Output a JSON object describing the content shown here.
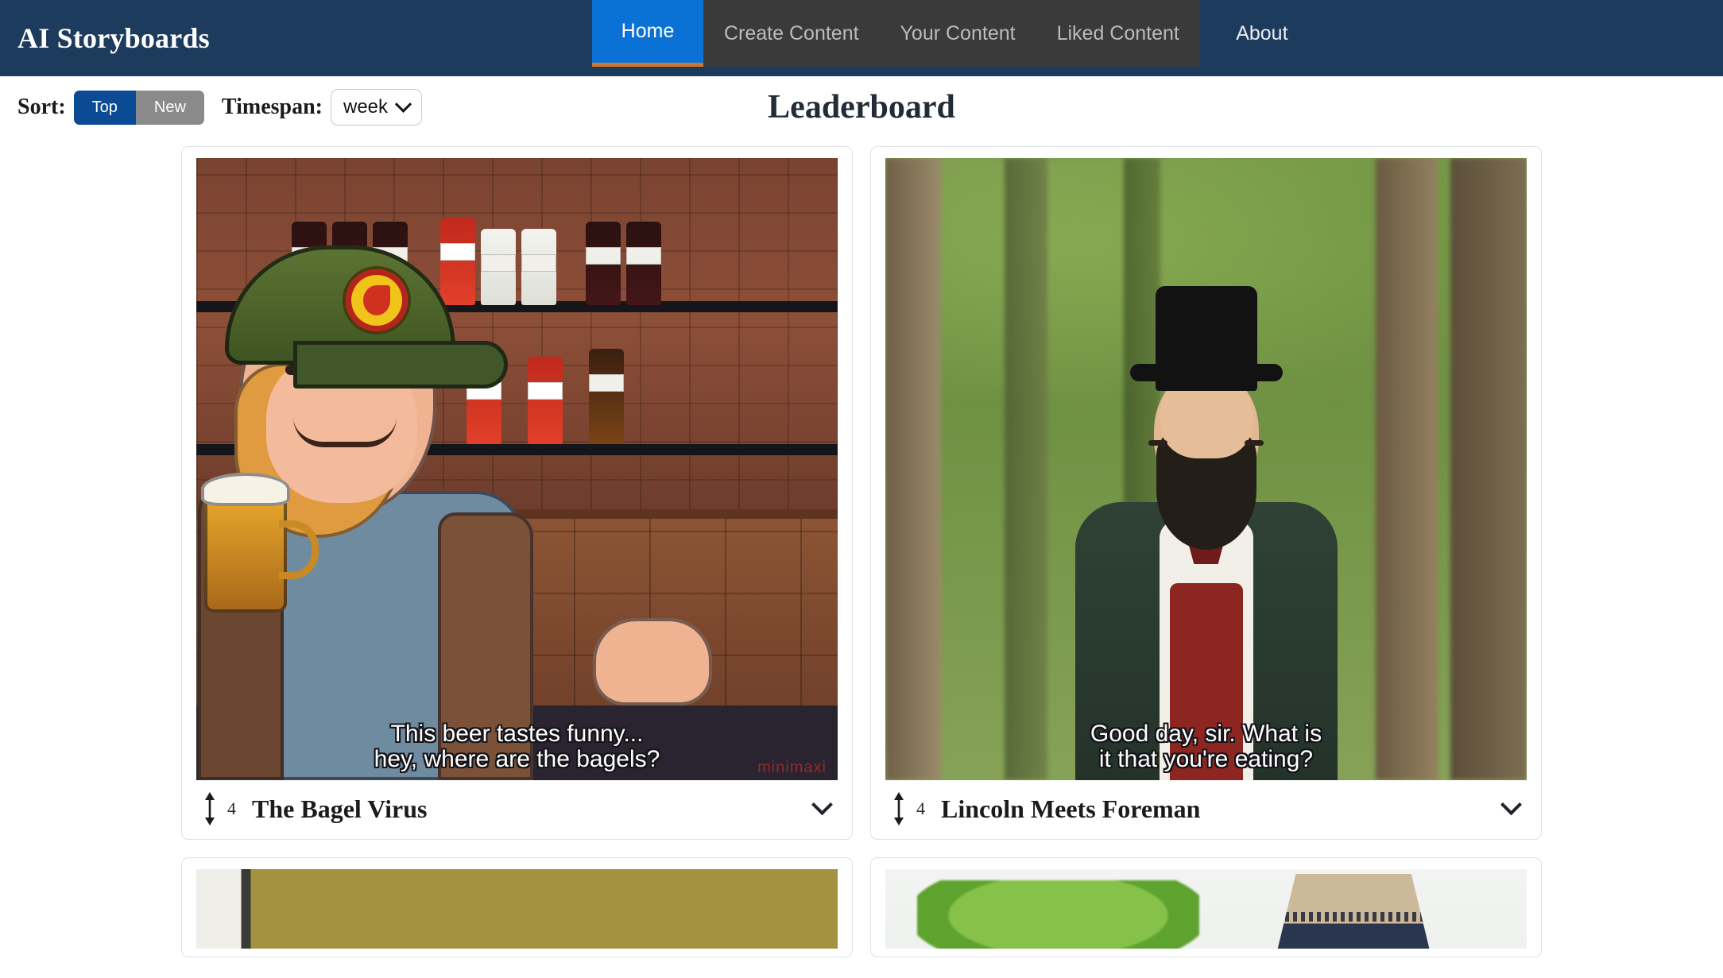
{
  "brand": "AI Storyboards",
  "nav": {
    "tabs": [
      {
        "label": "Home",
        "active": true
      },
      {
        "label": "Create Content",
        "active": false
      },
      {
        "label": "Your Content",
        "active": false
      },
      {
        "label": "Liked Content",
        "active": false
      }
    ],
    "plain_link": "About",
    "active_color": "#0a72d4",
    "accent_color": "#d2752c",
    "bar_color": "#1d3b5c"
  },
  "controls": {
    "sort_label": "Sort:",
    "sort_top": "Top",
    "sort_new": "New",
    "sort_selected": "Top",
    "timespan_label": "Timespan:",
    "timespan_value": "week",
    "timespan_icon": "chevron-down-icon"
  },
  "page_title": "Leaderboard",
  "cards": [
    {
      "title": "The Bagel Virus",
      "score": "4",
      "caption": "This beer tastes funny...\nhey, where are the bagels?",
      "watermark": "minimaxi",
      "vote_icon": "up-down-arrow-icon",
      "expand_icon": "chevron-down-icon"
    },
    {
      "title": "Lincoln Meets Foreman",
      "score": "4",
      "caption": "Good day, sir. What is\nit that you're eating?",
      "vote_icon": "up-down-arrow-icon",
      "expand_icon": "chevron-down-icon"
    }
  ],
  "cards_row2": [
    {
      "preview": "olive-room-image"
    },
    {
      "preview": "eiffel-tower-image"
    }
  ]
}
